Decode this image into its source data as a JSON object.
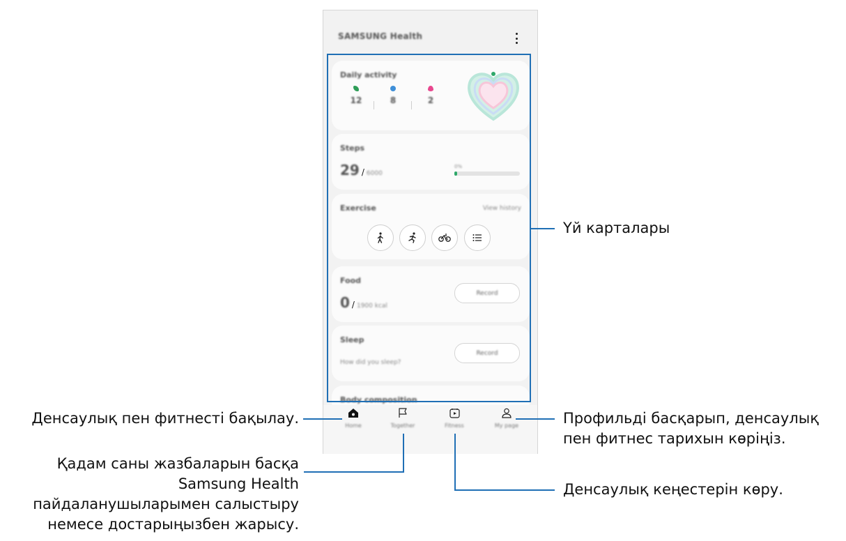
{
  "app": {
    "title": "SAMSUNG Health",
    "more_icon": "more-vertical-icon"
  },
  "cards": {
    "daily_activity": {
      "title": "Daily activity",
      "stats": [
        {
          "icon": "steps-icon",
          "color": "#2e9d57",
          "value": "12"
        },
        {
          "icon": "time-icon",
          "color": "#3f8fd8",
          "value": "8"
        },
        {
          "icon": "flame-icon",
          "color": "#e8478e",
          "value": "2"
        }
      ]
    },
    "steps": {
      "title": "Steps",
      "value": "29",
      "separator": "/",
      "target": "6000",
      "progress_label": "0%",
      "progress_color": "#2fa86a"
    },
    "exercise": {
      "title": "Exercise",
      "link": "View history",
      "icons": [
        "walking-icon",
        "running-icon",
        "cycling-icon",
        "list-icon"
      ]
    },
    "food": {
      "title": "Food",
      "value": "0",
      "separator": "/",
      "target": "1900 kcal",
      "button": "Record"
    },
    "sleep": {
      "title": "Sleep",
      "question": "How did you sleep?",
      "button": "Record"
    },
    "body": {
      "title": "Body composition"
    }
  },
  "nav": [
    {
      "icon": "home-icon",
      "label": "Home"
    },
    {
      "icon": "flag-icon",
      "label": "Together"
    },
    {
      "icon": "play-icon",
      "label": "Fitness"
    },
    {
      "icon": "profile-icon",
      "label": "My page"
    }
  ],
  "callouts": {
    "home_cards": "Үй карталары",
    "track_health": "Денсаулық пен фитнесті бақылау.",
    "profile": [
      "Профильді басқарып, денсаулық",
      "пен фитнес тарихын көріңіз."
    ],
    "together": [
      "Қадам саны жазбаларын басқа",
      "Samsung Health",
      "пайдаланушыларымен салыстыру",
      "немесе достарыңызбен жарысу."
    ],
    "tips": "Денсаулық кеңестерін көру."
  },
  "colors": {
    "callout_line": "#1f6fb5",
    "heart_outer": "#b9e6d9",
    "heart_inner": "#f7c6d9"
  }
}
